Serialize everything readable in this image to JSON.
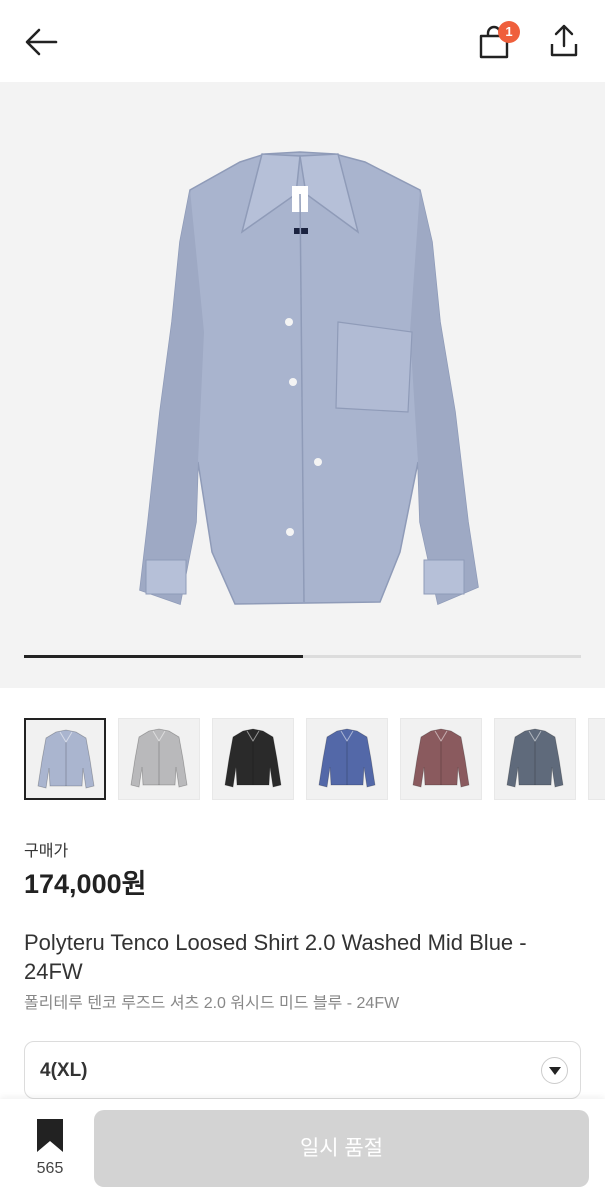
{
  "header": {
    "back_icon": "arrow-left-icon",
    "cart_icon": "shopping-bag-icon",
    "cart_count": "1",
    "share_icon": "share-icon",
    "badge_color": "#ef5f3c"
  },
  "gallery": {
    "main_image": "light blue long-sleeve shirt",
    "progress": 0.5,
    "thumbnails": [
      {
        "name": "light-blue-shirt",
        "color": "#aab5cf",
        "selected": true
      },
      {
        "name": "light-grey-shirt",
        "color": "#b9b9bb",
        "selected": false
      },
      {
        "name": "black-shirt",
        "color": "#2a2a2a",
        "selected": false
      },
      {
        "name": "royal-blue-shirt",
        "color": "#5368a8",
        "selected": false
      },
      {
        "name": "burgundy-shirt",
        "color": "#8a5a5e",
        "selected": false
      },
      {
        "name": "slate-grey-shirt",
        "color": "#5f6a7b",
        "selected": false
      }
    ]
  },
  "product": {
    "price_label": "구매가",
    "price": "174,000원",
    "title_en": "Polyteru Tenco Loosed Shirt 2.0 Washed Mid Blue - 24FW",
    "title_ko": "폴리테루 텐코 루즈드 셔츠 2.0 워시드 미드 블루 - 24FW"
  },
  "size_select": {
    "value": "4(XL)",
    "icon": "chevron-down-icon"
  },
  "footer": {
    "bookmark_icon": "bookmark-icon",
    "bookmark_count": "565",
    "cta_label": "일시 품절",
    "cta_color": "#d3d3d3"
  }
}
